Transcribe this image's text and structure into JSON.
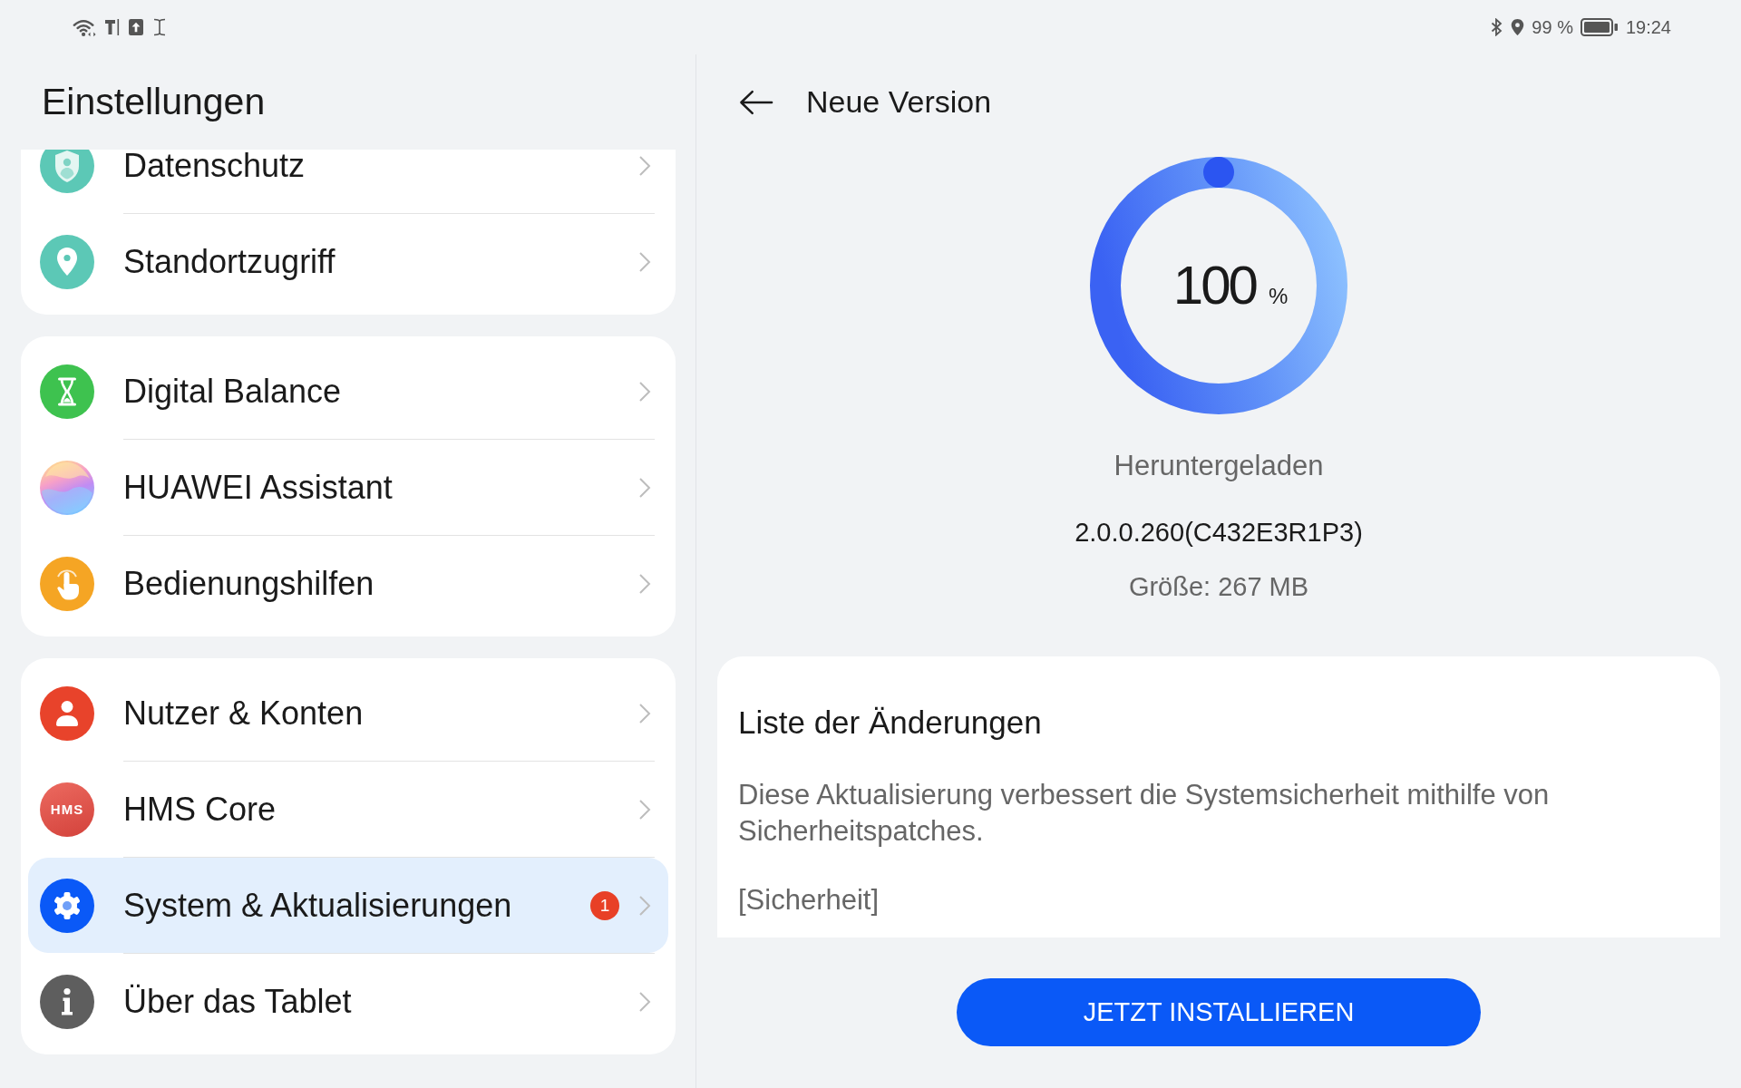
{
  "status_bar": {
    "battery_percent": "99 %",
    "time": "19:24"
  },
  "settings": {
    "title": "Einstellungen",
    "groups": [
      {
        "items": [
          {
            "label": "Datenschutz",
            "selected": false
          },
          {
            "label": "Standortzugriff",
            "selected": false
          }
        ]
      },
      {
        "items": [
          {
            "label": "Digital Balance",
            "selected": false
          },
          {
            "label": "HUAWEI Assistant",
            "selected": false
          },
          {
            "label": "Bedienungshilfen",
            "selected": false
          }
        ]
      },
      {
        "items": [
          {
            "label": "Nutzer & Konten",
            "selected": false
          },
          {
            "label": "HMS Core",
            "selected": false,
            "icon_label": "HMS"
          },
          {
            "label": "System & Aktualisierungen",
            "selected": true,
            "badge": "1"
          },
          {
            "label": "Über das Tablet",
            "selected": false
          }
        ]
      }
    ]
  },
  "update": {
    "title": "Neue Version",
    "progress": {
      "level": 1,
      "value": "100",
      "unit": "%"
    },
    "status": "Heruntergeladen",
    "version": "2.0.0.260(C432E3R1P3)",
    "size": "Größe: 267 MB",
    "changelog": {
      "title": "Liste der Änderungen",
      "paragraphs": [
        "Diese Aktualisierung verbessert die Systemsicherheit mithilfe von Sicherheitspatches.",
        "[Sicherheit]"
      ]
    },
    "install_button": "JETZT INSTALLIEREN"
  }
}
